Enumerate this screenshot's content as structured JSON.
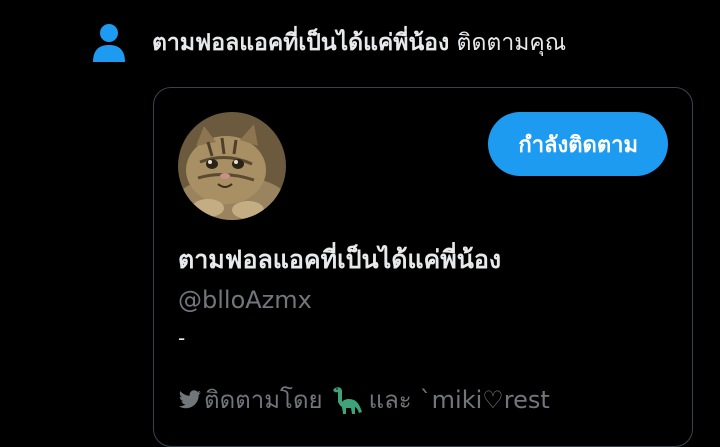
{
  "notification": {
    "icon": "person-icon",
    "name": "ตามฟอลแอคที่เป็นได้แค่พี่น้อง",
    "action": "ติดตามคุณ"
  },
  "card": {
    "avatar": "crying-cat-avatar",
    "follow_button_label": "กำลังติดตาม",
    "display_name": "ตามฟอลแอคที่เป็นได้แค่พี่น้อง",
    "handle": "@blloAzmx",
    "bio": "-",
    "followed_by": {
      "icon": "bird-icon",
      "prefix": "ติดตามโดย",
      "emoji": "dinosaur-icon",
      "conjunction": "และ",
      "other_user": "`miki♡rest"
    }
  },
  "colors": {
    "background": "#000000",
    "accent": "#1d9bf0",
    "text_primary": "#e7e9ea",
    "text_secondary": "#71767b",
    "border": "#38444d"
  }
}
